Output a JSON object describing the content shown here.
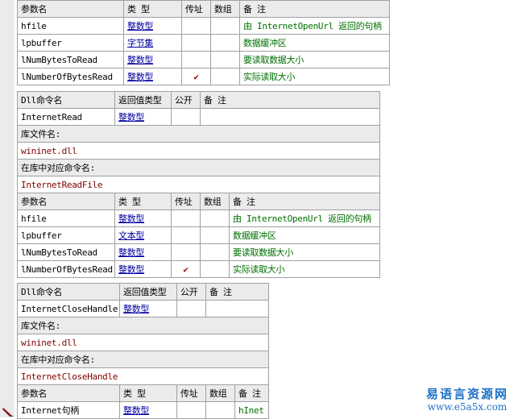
{
  "columns": {
    "param": [
      "参数名",
      "类 型",
      "传址",
      "数组",
      "备 注"
    ],
    "dll": [
      "Dll命令名",
      "返回值类型",
      "公开",
      "备 注"
    ],
    "lib_label": "库文件名:",
    "alias_label": "在库中对应命令名:"
  },
  "top_params": [
    {
      "name": "hfile",
      "type": "整数型",
      "byref": "",
      "array": "",
      "note": "由 InternetOpenUrl 返回的句柄"
    },
    {
      "name": "lpbuffer",
      "type": "字节集",
      "byref": "",
      "array": "",
      "note": "数据缓冲区"
    },
    {
      "name": "lNumBytesToRead",
      "type": "整数型",
      "byref": "",
      "array": "",
      "note": "要读取数据大小"
    },
    {
      "name": "lNumberOfBytesRead",
      "type": "整数型",
      "byref": "✔",
      "array": "",
      "note": "实际读取大小"
    }
  ],
  "cmd_read": {
    "name": "InternetRead",
    "ret": "整数型",
    "public": "",
    "note": "",
    "lib": "wininet.dll",
    "alias": "InternetReadFile",
    "params": [
      {
        "name": "hfile",
        "type": "整数型",
        "byref": "",
        "array": "",
        "note": "由 InternetOpenUrl 返回的句柄"
      },
      {
        "name": "lpbuffer",
        "type": "文本型",
        "byref": "",
        "array": "",
        "note": "数据缓冲区"
      },
      {
        "name": "lNumBytesToRead",
        "type": "整数型",
        "byref": "",
        "array": "",
        "note": "要读取数据大小"
      },
      {
        "name": "lNumberOfBytesRead",
        "type": "整数型",
        "byref": "✔",
        "array": "",
        "note": "实际读取大小"
      }
    ]
  },
  "cmd_close": {
    "name": "InternetCloseHandle",
    "ret": "整数型",
    "public": "",
    "note": "",
    "lib": "wininet.dll",
    "alias": "InternetCloseHandle",
    "params": [
      {
        "name": "Internet句柄",
        "type": "整数型",
        "byref": "",
        "array": "",
        "note": "hInet"
      }
    ]
  },
  "watermark": {
    "line1": "易语言资源网",
    "line2": "www.e5a5x.com"
  },
  "colors": {
    "header_bg": "#ebebeb",
    "border": "#a0a0a0",
    "type_text": "#0000a0",
    "note_text": "#007000",
    "dll_text": "#800000",
    "check": "#a00000",
    "brand": "#1c6fc6"
  }
}
